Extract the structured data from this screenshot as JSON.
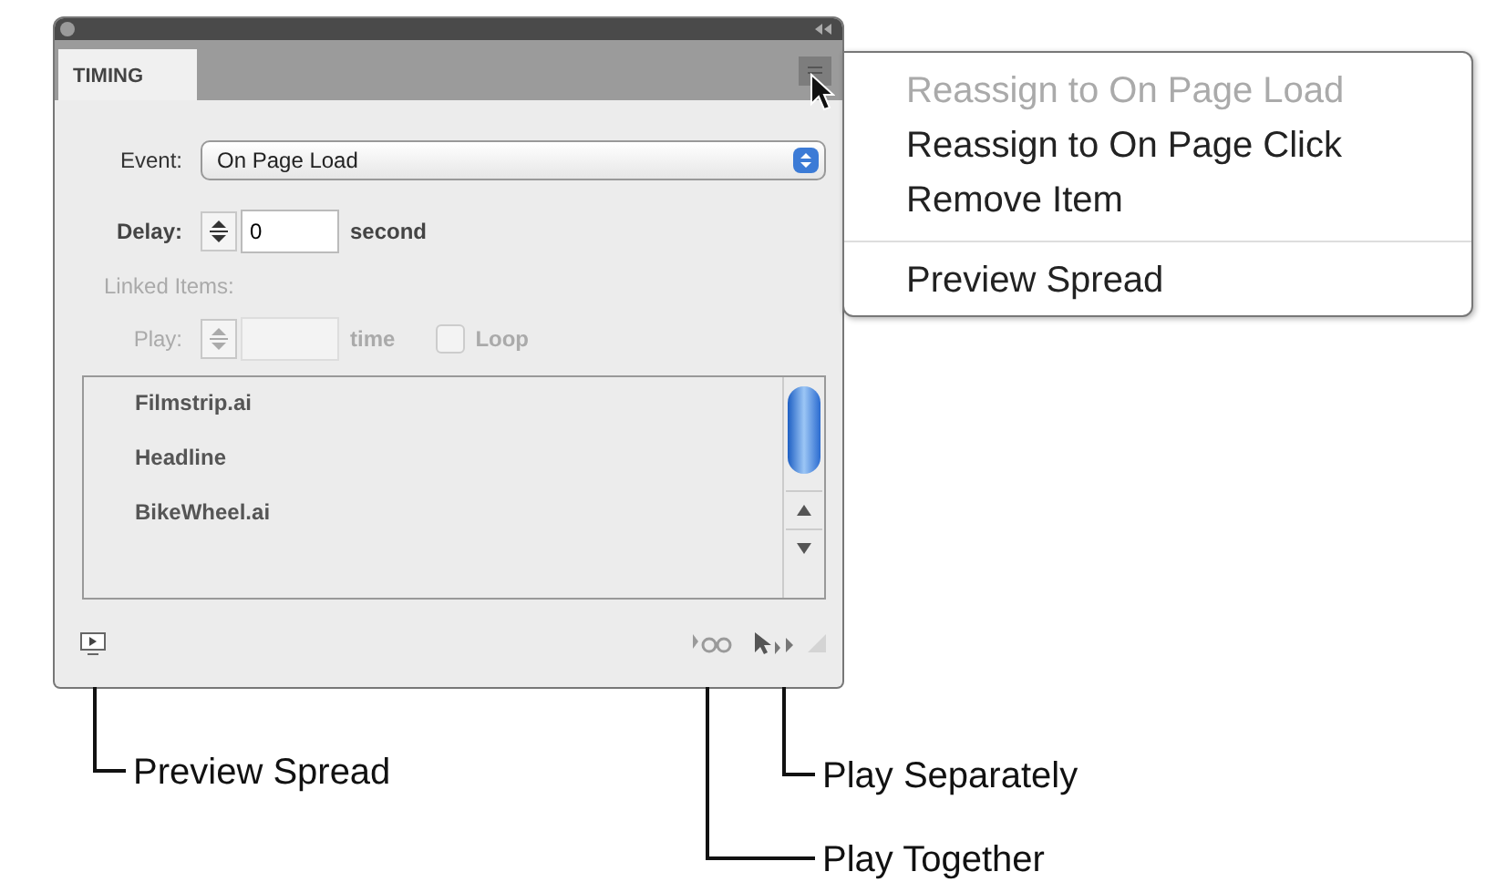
{
  "panel": {
    "tab": "TIMING",
    "event": {
      "label": "Event:",
      "value": "On Page Load"
    },
    "delay": {
      "label": "Delay:",
      "value": "0",
      "unit": "second"
    },
    "linked_items": {
      "label": "Linked Items:",
      "disabled": true
    },
    "play": {
      "label": "Play:",
      "unit": "time",
      "disabled": true,
      "loop": {
        "label": "Loop",
        "checked": false
      }
    },
    "items": [
      {
        "name": "Filmstrip.ai",
        "selected": false
      },
      {
        "name": "Headline",
        "selected": false
      },
      {
        "name": "BikeWheel.ai",
        "selected": false
      }
    ]
  },
  "menu": [
    {
      "label": "Reassign to On Page Load",
      "disabled": true
    },
    {
      "label": "Reassign to On Page Click",
      "disabled": false
    },
    {
      "label": "Remove Item",
      "disabled": false
    },
    {
      "kind": "separator"
    },
    {
      "label": "Preview Spread",
      "disabled": false
    }
  ],
  "callouts": [
    {
      "label": "Preview Spread",
      "kind": "preview"
    },
    {
      "label": "Play Separately",
      "kind": "separately"
    },
    {
      "label": "Play Together",
      "kind": "together"
    }
  ]
}
